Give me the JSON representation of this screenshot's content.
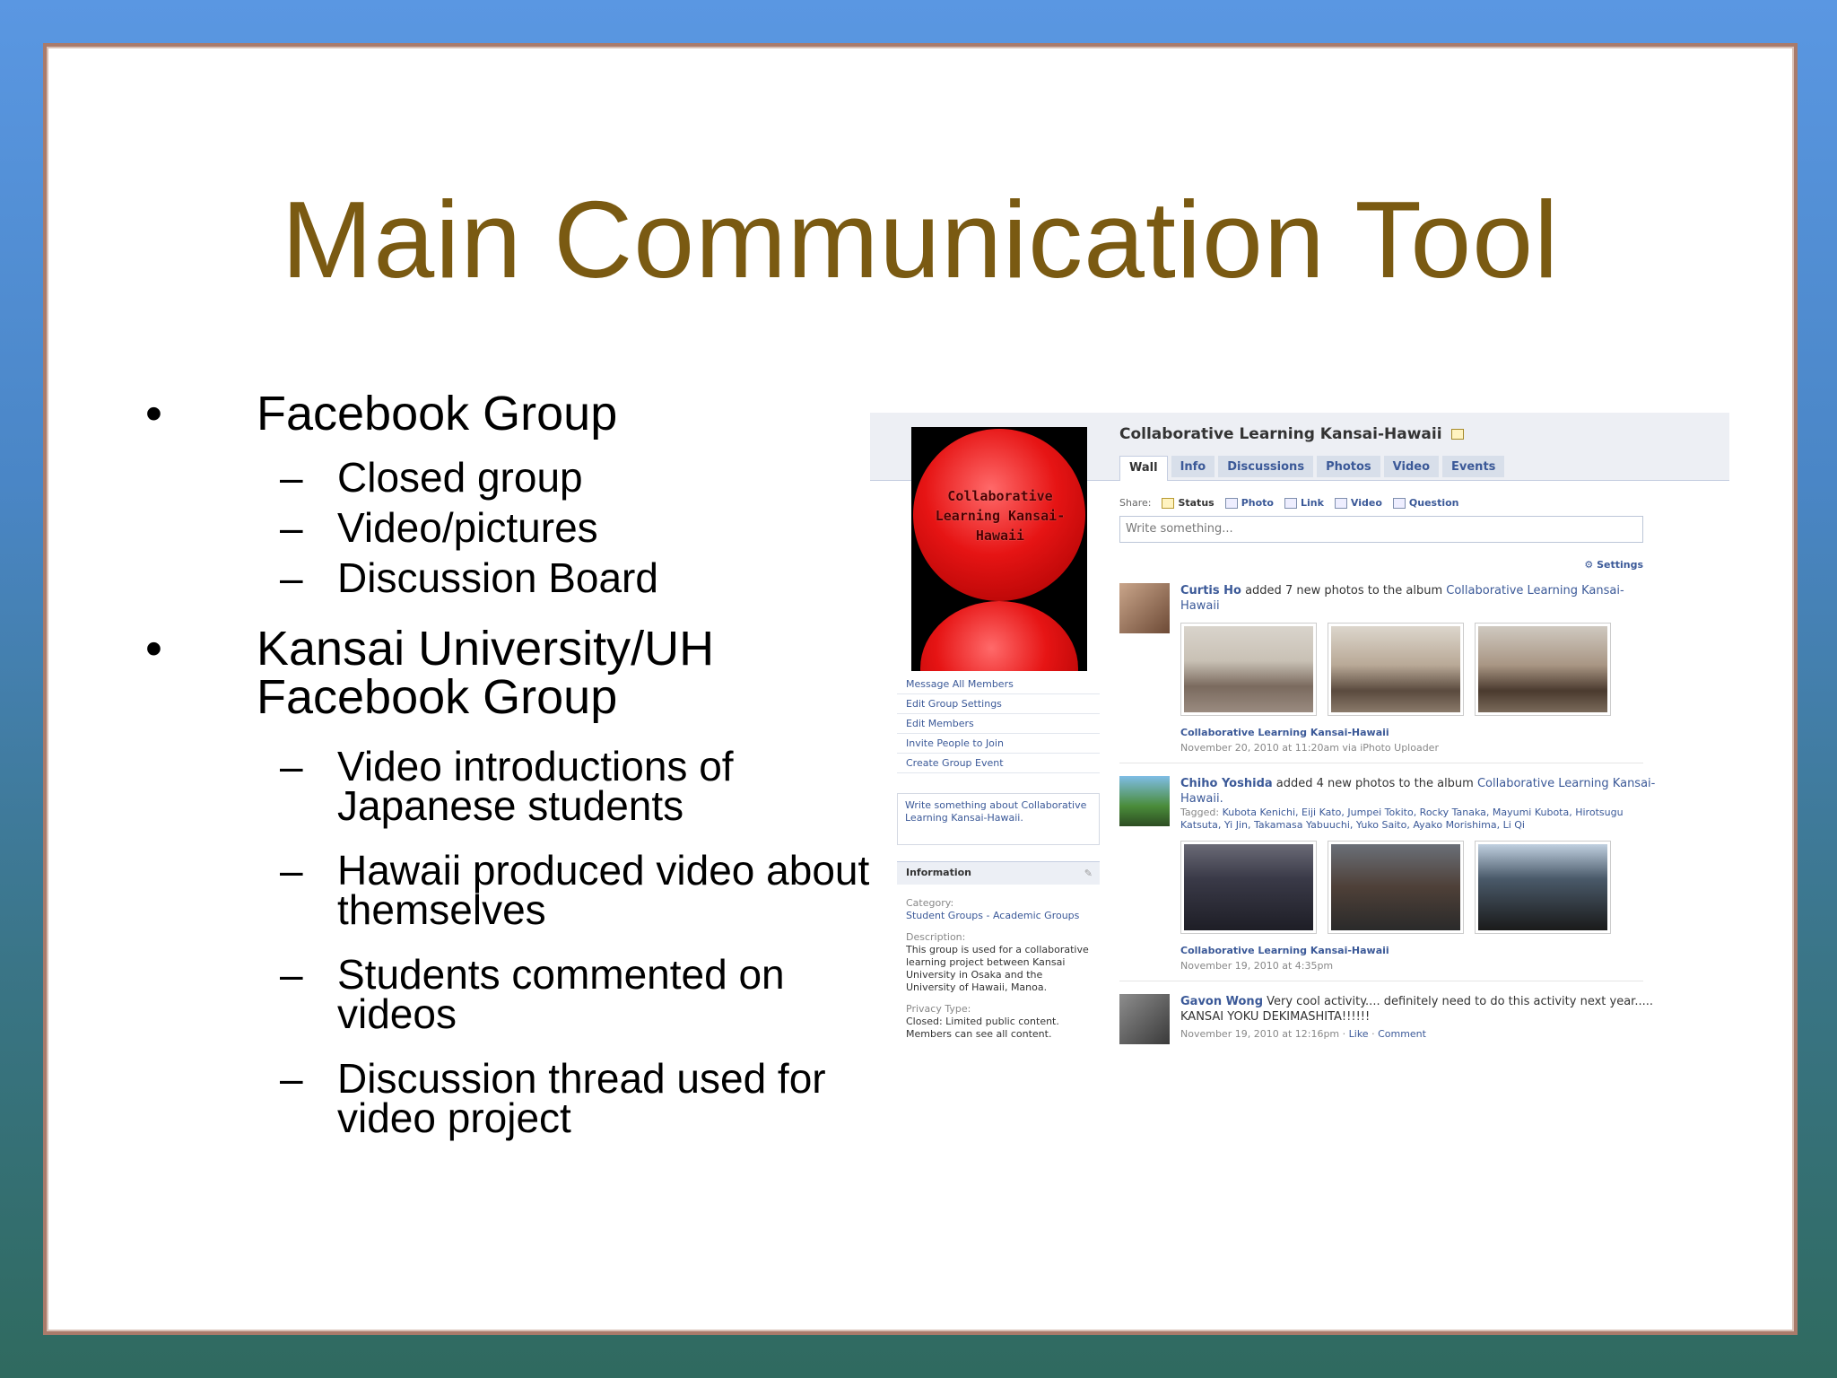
{
  "slide": {
    "title": "Main Communication Tool",
    "bullets": [
      {
        "text": "Facebook Group",
        "subs": [
          "Closed group",
          "Video/pictures",
          "Discussion Board"
        ]
      },
      {
        "text": "Kansai University/UH\nFacebook Group",
        "subs": [
          "Video introductions of\nJapanese students",
          "Hawaii produced video about\nthemselves",
          "Students commented on\nvideos",
          "Discussion thread used for\nvideo project"
        ]
      }
    ],
    "bullet_glyph": "•",
    "dash_glyph": "–"
  },
  "facebook": {
    "group_title": "Collaborative Learning Kansai-Hawaii",
    "logo_text": "Collaborative Learning Kansai-Hawaii",
    "tabs": [
      "Wall",
      "Info",
      "Discussions",
      "Photos",
      "Video",
      "Events"
    ],
    "active_tab": "Wall",
    "left_links": [
      "Message All Members",
      "Edit Group Settings",
      "Edit Members",
      "Invite People to Join",
      "Create Group Event"
    ],
    "write_about": "Write something about Collaborative Learning Kansai-Hawaii.",
    "info": {
      "header": "Information",
      "category_label": "Category:",
      "category": "Student Groups - Academic Groups",
      "description_label": "Description:",
      "description": "This group is used for a collaborative learning project between Kansai University in Osaka and the University of Hawaii, Manoa.",
      "privacy_label": "Privacy Type:",
      "privacy": "Closed: Limited public content. Members can see all content."
    },
    "share_label": "Share:",
    "share_items": [
      "Status",
      "Photo",
      "Link",
      "Video",
      "Question"
    ],
    "write_placeholder": "Write something...",
    "settings": "⚙ Settings",
    "posts": [
      {
        "name": "Curtis Ho",
        "action": " added 7 new photos to the album ",
        "album_link": "Collaborative Learning Kansai-Hawaii",
        "album": "Collaborative Learning Kansai-Hawaii",
        "meta": "November 20, 2010 at 11:20am via iPhoto Uploader"
      },
      {
        "name": "Chiho Yoshida",
        "action": " added 4 new photos to the album ",
        "album_link": "Collaborative Learning Kansai-Hawaii.",
        "tagged_label": "Tagged:",
        "tagged": "Kubota Kenichi, Eiji Kato, Jumpei Tokito, Rocky Tanaka, Mayumi Kubota, Hirotsugu Katsuta, Yi Jin, Takamasa Yabuuchi, Yuko Saito, Ayako Morishima, Li Qi",
        "album": "Collaborative Learning Kansai-Hawaii",
        "meta": "November 19, 2010 at 4:35pm"
      },
      {
        "name": "Gavon Wong",
        "text": " Very cool activity.... definitely need to do this activity next year..... KANSAI YOKU DEKIMASHITA!!!!!!",
        "meta": "November 19, 2010 at 12:16pm · ",
        "like": "Like",
        "sep": " · ",
        "comment": "Comment"
      }
    ]
  }
}
